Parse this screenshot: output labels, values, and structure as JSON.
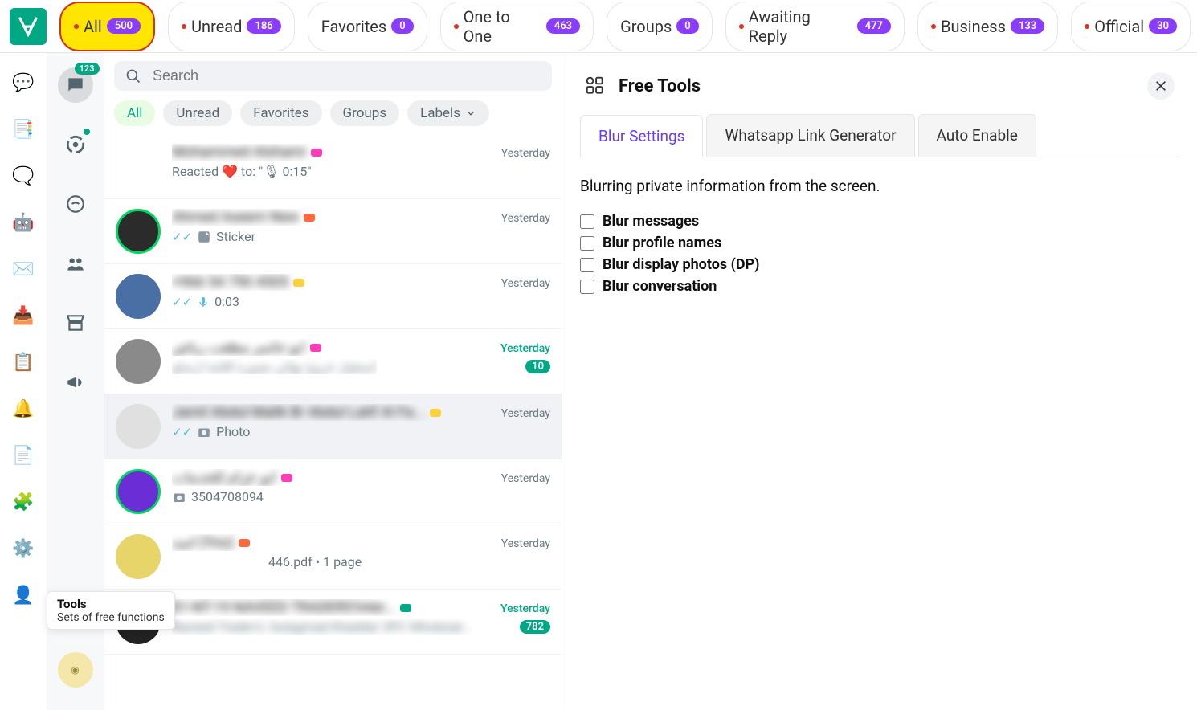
{
  "topTabs": [
    {
      "label": "All",
      "count": "500",
      "dot": true,
      "active": true
    },
    {
      "label": "Unread",
      "count": "186",
      "dot": true,
      "active": false
    },
    {
      "label": "Favorites",
      "count": "0",
      "dot": false,
      "active": false
    },
    {
      "label": "One to One",
      "count": "463",
      "dot": true,
      "active": false
    },
    {
      "label": "Groups",
      "count": "0",
      "dot": false,
      "active": false
    },
    {
      "label": "Awaiting Reply",
      "count": "477",
      "dot": true,
      "active": false
    },
    {
      "label": "Business",
      "count": "133",
      "dot": true,
      "active": false
    },
    {
      "label": "Official",
      "count": "30",
      "dot": true,
      "active": false
    }
  ],
  "railIcons": [
    {
      "name": "chat-bubble-icon",
      "glyph": "💬"
    },
    {
      "name": "multi-message-icon",
      "glyph": "📑"
    },
    {
      "name": "chat-stack-icon",
      "glyph": "🗨️"
    },
    {
      "name": "bot-icon",
      "glyph": "🤖"
    },
    {
      "name": "mail-icon",
      "glyph": "✉️"
    },
    {
      "name": "inbox-icon",
      "glyph": "📥"
    },
    {
      "name": "clipboard-icon",
      "glyph": "📋"
    },
    {
      "name": "bell-icon",
      "glyph": "🔔"
    },
    {
      "name": "form-icon",
      "glyph": "📄"
    },
    {
      "name": "widgets-icon",
      "glyph": "🧩"
    },
    {
      "name": "gear-icon",
      "glyph": "⚙️"
    },
    {
      "name": "support-icon",
      "glyph": "👤"
    }
  ],
  "side2": {
    "badge": "123",
    "items": [
      {
        "name": "chats-icon",
        "active": true,
        "badge": true
      },
      {
        "name": "status-icon",
        "active": false,
        "dot": true
      },
      {
        "name": "channels-icon",
        "active": false
      },
      {
        "name": "communities-icon",
        "active": false
      },
      {
        "name": "store-icon",
        "active": false
      },
      {
        "name": "megaphone-icon",
        "active": false
      }
    ]
  },
  "tooltip": {
    "title": "Tools",
    "sub": "Sets of free functions"
  },
  "search": {
    "placeholder": "Search"
  },
  "chips": [
    {
      "label": "All",
      "active": true
    },
    {
      "label": "Unread",
      "active": false
    },
    {
      "label": "Favorites",
      "active": false
    },
    {
      "label": "Groups",
      "active": false
    },
    {
      "label": "Labels",
      "active": false,
      "chevron": true
    }
  ],
  "chats": [
    {
      "name": "Mohammed Alshami",
      "time": "Yesterday",
      "sub": "Reacted ❤️ to: \"🎙 0:15\"",
      "subBlur": false,
      "labelColor": "#ff3db8",
      "avatar": "#fff",
      "ring": false
    },
    {
      "name": "Ahmed Aseem New",
      "time": "Yesterday",
      "sub": "Sticker",
      "subBlur": false,
      "check": true,
      "stickerIcon": true,
      "labelColor": "#ff6a3d",
      "avatar": "#2b2b2b",
      "ring": true
    },
    {
      "name": "+966 54 790 4505",
      "time": "Yesterday",
      "sub": "0:03",
      "subBlur": false,
      "check": true,
      "voiceIcon": true,
      "labelColor": "#ffd23d",
      "avatar": "#4a6fa5",
      "ring": false
    },
    {
      "name": "ابو جاسر مطعب رياض",
      "time": "Yesterday",
      "timeUnread": true,
      "sub": "استقبل خروج نهائي بصوره اقامة ارسلو",
      "subBlur": true,
      "unread": "10",
      "labelColor": "#ff3db8",
      "avatar": "#8a8a8a",
      "ring": false
    },
    {
      "name": "Jamil Abdul Malik Br Abdul Latif Al Fa...",
      "time": "Yesterday",
      "sub": "Photo",
      "subBlur": false,
      "check": true,
      "photoIcon": true,
      "labelColor": "#ffd23d",
      "avatar": "#e0e0e0",
      "ring": false,
      "selected": true
    },
    {
      "name": "ابو عزام للخدمات",
      "time": "Yesterday",
      "sub": "3504708094",
      "subBlur": false,
      "photoIcon": true,
      "labelColor": "#ff3db8",
      "avatar": "#6b2ed6",
      "ring": true
    },
    {
      "name": "اسد (You)",
      "time": "Yesterday",
      "sub": "446.pdf • 1 page",
      "subBlur": false,
      "labelColor": "#ff6a3d",
      "avatar": "#e8d56a",
      "ring": false,
      "indentSub": true
    },
    {
      "name": "01-NT-19 NAVEED TRADERS'Inter...",
      "time": "Yesterday",
      "timeUnread": true,
      "sub": "Naveed Trader's: Gulagmad Khaddar 3PC Wholesal...",
      "subBlur": true,
      "unread": "782",
      "avatar": "#222",
      "ring": false,
      "labelColor": "#00a884"
    }
  ],
  "rightPanel": {
    "title": "Free Tools",
    "tabs": [
      {
        "label": "Blur Settings",
        "active": true
      },
      {
        "label": "Whatsapp Link Generator",
        "active": false
      },
      {
        "label": "Auto Enable",
        "active": false
      }
    ],
    "desc": "Blurring private information from the screen.",
    "checks": [
      "Blur messages",
      "Blur profile names",
      "Blur display photos (DP)",
      "Blur conversation"
    ]
  }
}
